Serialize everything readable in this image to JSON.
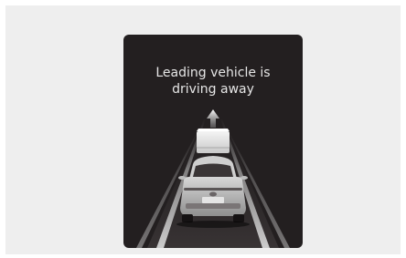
{
  "alert": {
    "line1": "Leading vehicle is",
    "line2": "driving away"
  },
  "icons": {
    "direction": "up-arrow-icon",
    "leading_vehicle": "leading-vehicle-icon",
    "own_vehicle": "own-vehicle-rear-icon",
    "lanes": "lane-lines-icon"
  },
  "colors": {
    "screen_background": "#231f20",
    "text": "#e6e6e6",
    "outer_frame": "#eeeeee"
  }
}
